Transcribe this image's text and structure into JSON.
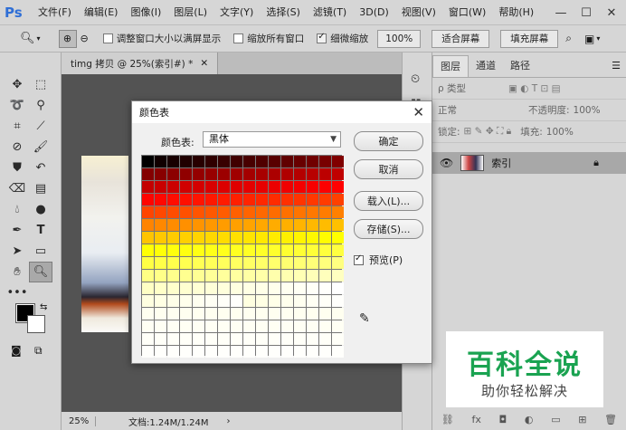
{
  "app": {
    "logo": "Ps"
  },
  "menu": [
    "文件(F)",
    "编辑(E)",
    "图像(I)",
    "图层(L)",
    "文字(Y)",
    "选择(S)",
    "滤镜(T)",
    "3D(D)",
    "视图(V)",
    "窗口(W)",
    "帮助(H)"
  ],
  "options": {
    "resize_window": "调整窗口大小以满屏显示",
    "zoom_all": "缩放所有窗口",
    "scrubby_zoom": "细微缩放",
    "zoom_value": "100%",
    "fit_screen": "适合屏幕",
    "fill_screen": "填充屏幕"
  },
  "document": {
    "tab_title": "timg 拷贝 @ 25%(索引#) *",
    "zoom": "25%",
    "doc_size": "文档:1.24M/1.24M"
  },
  "panels": {
    "tabs": [
      "图层",
      "通道",
      "路径"
    ],
    "filter_type": "ρ 类型",
    "blend_mode": "正常",
    "opacity_label": "不透明度:",
    "opacity_value": "100%",
    "lock_label": "锁定:",
    "fill_label": "填充:",
    "fill_value": "100%",
    "layer_name": "索引"
  },
  "dialog": {
    "title": "颜色表",
    "table_label": "颜色表:",
    "table_value": "黑体",
    "ok": "确定",
    "cancel": "取消",
    "load": "载入(L)...",
    "save": "存储(S)...",
    "preview": "预览(P)",
    "colors": [
      "#000000",
      "#100000",
      "#180000",
      "#200000",
      "#280000",
      "#300000",
      "#380000",
      "#400000",
      "#480000",
      "#500000",
      "#580000",
      "#600000",
      "#680000",
      "#700000",
      "#780000",
      "#800000",
      "#840000",
      "#880000",
      "#8c0000",
      "#900000",
      "#940000",
      "#980000",
      "#9c0000",
      "#a00000",
      "#a40000",
      "#a80000",
      "#ac0000",
      "#b00000",
      "#b40000",
      "#b80000",
      "#bc0000",
      "#c00000",
      "#c40000",
      "#c80000",
      "#cc0000",
      "#d00000",
      "#d40000",
      "#d80000",
      "#dc0000",
      "#e00000",
      "#e40000",
      "#e80000",
      "#ec0000",
      "#f00000",
      "#f40000",
      "#f80000",
      "#fc0000",
      "#ff0000",
      "#ff0400",
      "#ff0800",
      "#ff0c00",
      "#ff1000",
      "#ff1400",
      "#ff1800",
      "#ff1c00",
      "#ff2000",
      "#ff2400",
      "#ff2800",
      "#ff2c00",
      "#ff3000",
      "#ff3400",
      "#ff3800",
      "#ff3c00",
      "#ff4000",
      "#ff4400",
      "#ff4800",
      "#ff4c00",
      "#ff5000",
      "#ff5400",
      "#ff5800",
      "#ff5c00",
      "#ff6000",
      "#ff6400",
      "#ff6800",
      "#ff6c00",
      "#ff7000",
      "#ff7400",
      "#ff7800",
      "#ff7c00",
      "#ff8000",
      "#ff8400",
      "#ff8800",
      "#ff8c00",
      "#ff9000",
      "#ff9400",
      "#ff9800",
      "#ff9c00",
      "#ffa000",
      "#ffa400",
      "#ffa800",
      "#ffac00",
      "#ffb000",
      "#ffb400",
      "#ffb800",
      "#ffbc00",
      "#ffc000",
      "#ffc400",
      "#ffc800",
      "#ffcc00",
      "#ffd000",
      "#ffd400",
      "#ffd800",
      "#ffdc00",
      "#ffe000",
      "#ffe400",
      "#ffe800",
      "#ffec00",
      "#fff000",
      "#fff400",
      "#fff800",
      "#fffc00",
      "#ffff00",
      "#ffff04",
      "#ffff08",
      "#ffff0c",
      "#ffff10",
      "#ffff14",
      "#ffff18",
      "#ffff1c",
      "#ffff20",
      "#ffff24",
      "#ffff28",
      "#ffff2c",
      "#ffff30",
      "#ffff34",
      "#ffff38",
      "#ffff3c",
      "#ffff40",
      "#ffff44",
      "#ffff48",
      "#ffff4c",
      "#ffff50",
      "#ffff54",
      "#ffff58",
      "#ffff5c",
      "#ffff60",
      "#ffff64",
      "#ffff68",
      "#ffff6c",
      "#ffff70",
      "#ffff74",
      "#ffff78",
      "#ffff7c",
      "#ffff80",
      "#ffff84",
      "#ffff88",
      "#ffff8c",
      "#ffff90",
      "#ffff94",
      "#ffff98",
      "#ffff9c",
      "#ffffa0",
      "#ffffa4",
      "#ffffa8",
      "#ffffac",
      "#ffffb0",
      "#ffffb4",
      "#ffffb8",
      "#ffffbc",
      "#ffffc0",
      "#ffffc4",
      "#ffffc8",
      "#ffffcc",
      "#ffffd0",
      "#ffffd4",
      "#ffffd8",
      "#ffffdc",
      "#ffffe0",
      "#ffffe4",
      "#ffffe8",
      "#ffffec",
      "#fffff0",
      "#fffff4",
      "#fffff8",
      "#fffffc",
      "#ffffff",
      "#ffffe0",
      "#ffffe4",
      "#ffffe8",
      "#ffffec",
      "#fffff0",
      "#fffff4",
      "#fffff8",
      "#fffffc",
      "#ffffe0",
      "#ffffe4",
      "#ffffe8",
      "#ffffec",
      "#fffff0",
      "#fffff4",
      "#fffff8",
      "#fffffc",
      "#fffff0",
      "#fffff0",
      "#fffff0",
      "#fffff0",
      "#fffff0",
      "#fffff0",
      "#fffff0",
      "#fffff0",
      "#fffff0",
      "#fffff0",
      "#fffff0",
      "#fffff0",
      "#fffff0",
      "#fffff0",
      "#fffff0",
      "#fffff0",
      "#fffff4",
      "#fffff4",
      "#fffff4",
      "#fffff4",
      "#fffff4",
      "#fffff4",
      "#fffff4",
      "#fffff4",
      "#fffff4",
      "#fffff4",
      "#fffff4",
      "#fffff4",
      "#fffff4",
      "#fffff4",
      "#fffff4",
      "#fffff4",
      "#fffff8",
      "#fffff8",
      "#fffff8",
      "#fffff8",
      "#fffff8",
      "#fffff8",
      "#fffff8",
      "#fffff8",
      "#fffff8",
      "#fffff8",
      "#fffff8",
      "#fffff8",
      "#fffff8",
      "#fffff8",
      "#fffff8",
      "#fffff8",
      "#fffffc",
      "#fffffc",
      "#fffffc",
      "#fffffc",
      "#fffffc",
      "#fffffc",
      "#fffffc",
      "#fffffc",
      "#fffffc",
      "#fffffc",
      "#fffffc",
      "#fffffc",
      "#fffffc",
      "#fffffc",
      "#fffffc",
      "#fffffc"
    ]
  },
  "watermark": {
    "title": "百科全说",
    "subtitle": "助你轻松解决",
    "title_color": "#1aa351"
  }
}
